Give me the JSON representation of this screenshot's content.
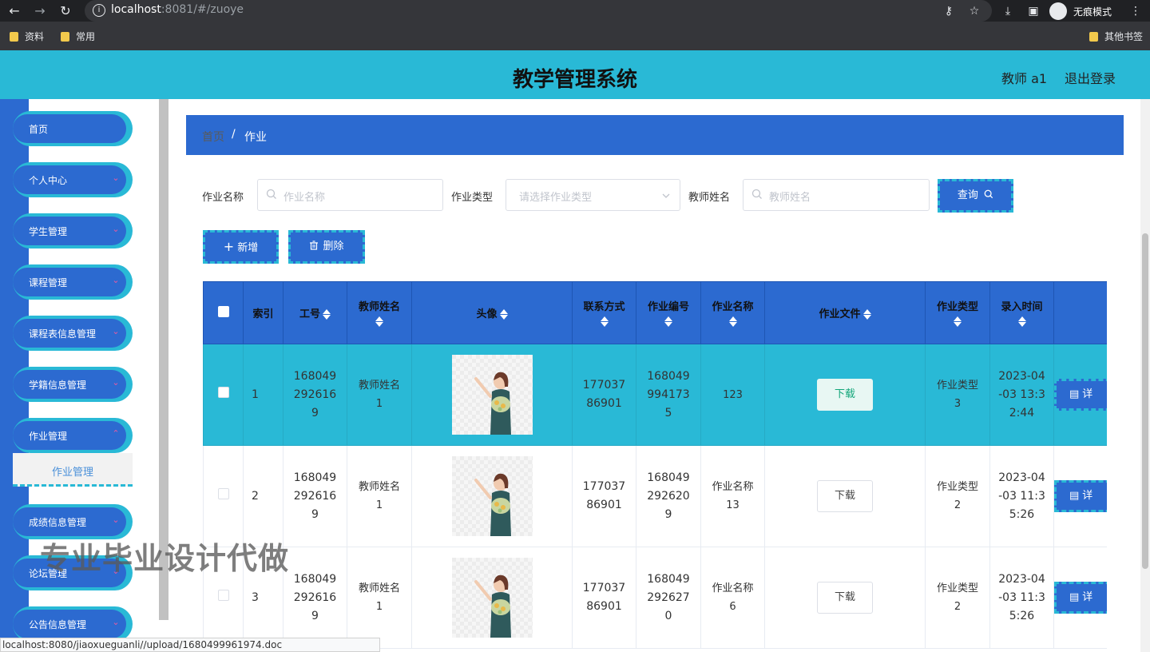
{
  "browser": {
    "url_host": "localhost",
    "url_path": ":8081/#/zuoye",
    "incognito_label": "无痕模式",
    "bookmarks": [
      "资料",
      "常用"
    ],
    "other_bookmarks": "其他书签"
  },
  "header": {
    "title": "教学管理系统",
    "user": "教师 a1",
    "logout": "退出登录"
  },
  "sidebar": {
    "items": [
      {
        "label": "首页"
      },
      {
        "label": "个人中心"
      },
      {
        "label": "学生管理"
      },
      {
        "label": "课程管理"
      },
      {
        "label": "课程表信息管理"
      },
      {
        "label": "学籍信息管理"
      },
      {
        "label": "作业管理"
      },
      {
        "label": "成绩信息管理"
      },
      {
        "label": "论坛管理"
      },
      {
        "label": "公告信息管理"
      }
    ],
    "sub_item": "作业管理"
  },
  "breadcrumb": {
    "home": "首页",
    "separator": "/",
    "current": "作业"
  },
  "search": {
    "name_label": "作业名称",
    "name_placeholder": "作业名称",
    "type_label": "作业类型",
    "type_placeholder": "请选择作业类型",
    "teacher_label": "教师姓名",
    "teacher_placeholder": "教师姓名",
    "query_button": "查询"
  },
  "actions": {
    "add": "新增",
    "delete": "删除"
  },
  "table": {
    "headers": {
      "index": "索引",
      "staff_no": "工号",
      "teacher_name": "教师姓名",
      "avatar": "头像",
      "contact": "联系方式",
      "hw_no": "作业编号",
      "hw_name": "作业名称",
      "hw_file": "作业文件",
      "hw_type": "作业类型",
      "entry_time": "录入时间"
    },
    "download_label": "下载",
    "detail_label": "详",
    "rows": [
      {
        "index": "1",
        "staff_no": "1680492926169",
        "teacher_name": "教师姓名1",
        "contact": "17703786901",
        "hw_no": "1680499941735",
        "hw_name": "123",
        "hw_type": "作业类型3",
        "entry_time": "2023-04-03 13:32:44"
      },
      {
        "index": "2",
        "staff_no": "1680492926169",
        "teacher_name": "教师姓名1",
        "contact": "17703786901",
        "hw_no": "1680492926209",
        "hw_name": "作业名称13",
        "hw_type": "作业类型2",
        "entry_time": "2023-04-03 11:35:26"
      },
      {
        "index": "3",
        "staff_no": "1680492926169",
        "teacher_name": "教师姓名1",
        "contact": "17703786901",
        "hw_no": "1680492926270",
        "hw_name": "作业名称6",
        "hw_type": "作业类型2",
        "entry_time": "2023-04-03 11:35:26"
      }
    ]
  },
  "watermark": "专业毕业设计代做",
  "status_url": "localhost:8080/jiaoxueguanli//upload/1680499961974.doc"
}
